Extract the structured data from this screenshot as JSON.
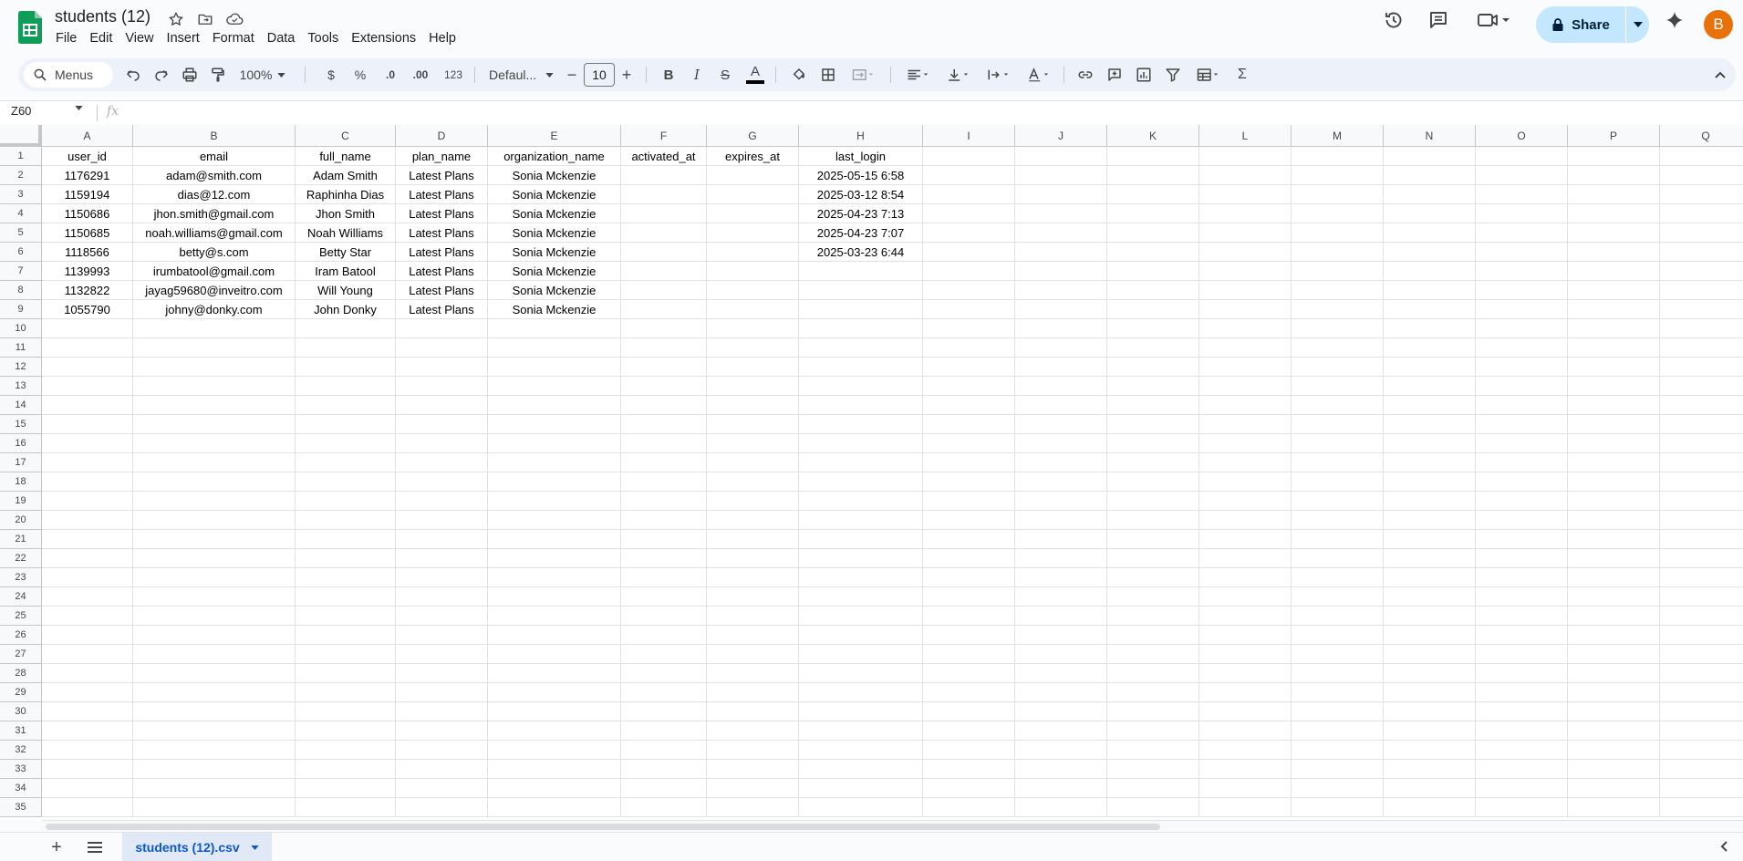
{
  "doc": {
    "title": "students (12)"
  },
  "menu": [
    "File",
    "Edit",
    "View",
    "Insert",
    "Format",
    "Data",
    "Tools",
    "Extensions",
    "Help"
  ],
  "header": {
    "share_label": "Share",
    "avatar_letter": "B"
  },
  "toolbar": {
    "search_label": "Menus",
    "zoom": "100%",
    "currency": "$",
    "percent": "%",
    "decimal_decrease": ".0",
    "decimal_increase": ".00",
    "number_format": "123",
    "font": "Defaul...",
    "font_size": "10",
    "minus": "−",
    "plus": "+",
    "bold": "B",
    "italic": "I",
    "strike": "S",
    "text_color_letter": "A",
    "sigma": "Σ"
  },
  "formula_bar": {
    "name_box": "Z60",
    "fx": "fx",
    "value": ""
  },
  "grid": {
    "columns": [
      "A",
      "B",
      "C",
      "D",
      "E",
      "F",
      "G",
      "H",
      "I",
      "J",
      "K",
      "L",
      "M",
      "N",
      "O",
      "P",
      "Q"
    ],
    "row_numbers": [
      "1",
      "2",
      "3",
      "4",
      "5",
      "6",
      "7",
      "8",
      "9",
      "10",
      "11",
      "12",
      "13",
      "14",
      "15",
      "16",
      "17",
      "18",
      "19",
      "20",
      "21",
      "22",
      "23",
      "24",
      "25",
      "26",
      "27",
      "28",
      "29",
      "30",
      "31",
      "32",
      "33",
      "34",
      "35"
    ],
    "rows": [
      [
        "user_id",
        "email",
        "full_name",
        "plan_name",
        "organization_name",
        "activated_at",
        "expires_at",
        "last_login"
      ],
      [
        "1176291",
        "adam@smith.com",
        "Adam Smith",
        "Latest Plans",
        "Sonia Mckenzie",
        "",
        "",
        "2025-05-15 6:58"
      ],
      [
        "1159194",
        "dias@12.com",
        "Raphinha  Dias",
        "Latest Plans",
        "Sonia Mckenzie",
        "",
        "",
        "2025-03-12 8:54"
      ],
      [
        "1150686",
        "jhon.smith@gmail.com",
        "Jhon Smith",
        "Latest Plans",
        "Sonia Mckenzie",
        "",
        "",
        "2025-04-23 7:13"
      ],
      [
        "1150685",
        "noah.williams@gmail.com",
        "Noah Williams",
        "Latest Plans",
        "Sonia Mckenzie",
        "",
        "",
        "2025-04-23 7:07"
      ],
      [
        "1118566",
        "betty@s.com",
        "Betty Star",
        "Latest Plans",
        "Sonia Mckenzie",
        "",
        "",
        "2025-03-23 6:44"
      ],
      [
        "1139993",
        "irumbatool@gmail.com",
        "Iram Batool",
        "Latest Plans",
        "Sonia Mckenzie",
        "",
        "",
        ""
      ],
      [
        "1132822",
        "jayag59680@inveitro.com",
        "Will Young",
        "Latest Plans",
        "Sonia Mckenzie",
        "",
        "",
        ""
      ],
      [
        "1055790",
        "johny@donky.com",
        "John Donky",
        "Latest Plans",
        "Sonia Mckenzie",
        "",
        "",
        ""
      ]
    ]
  },
  "sheet_tab": {
    "label": "students (12).csv"
  },
  "colors": {
    "accent": "#0b57d0",
    "share_bg": "#c2e7ff",
    "avatar": "#e8710a",
    "sheets_green": "#0f9d58"
  }
}
